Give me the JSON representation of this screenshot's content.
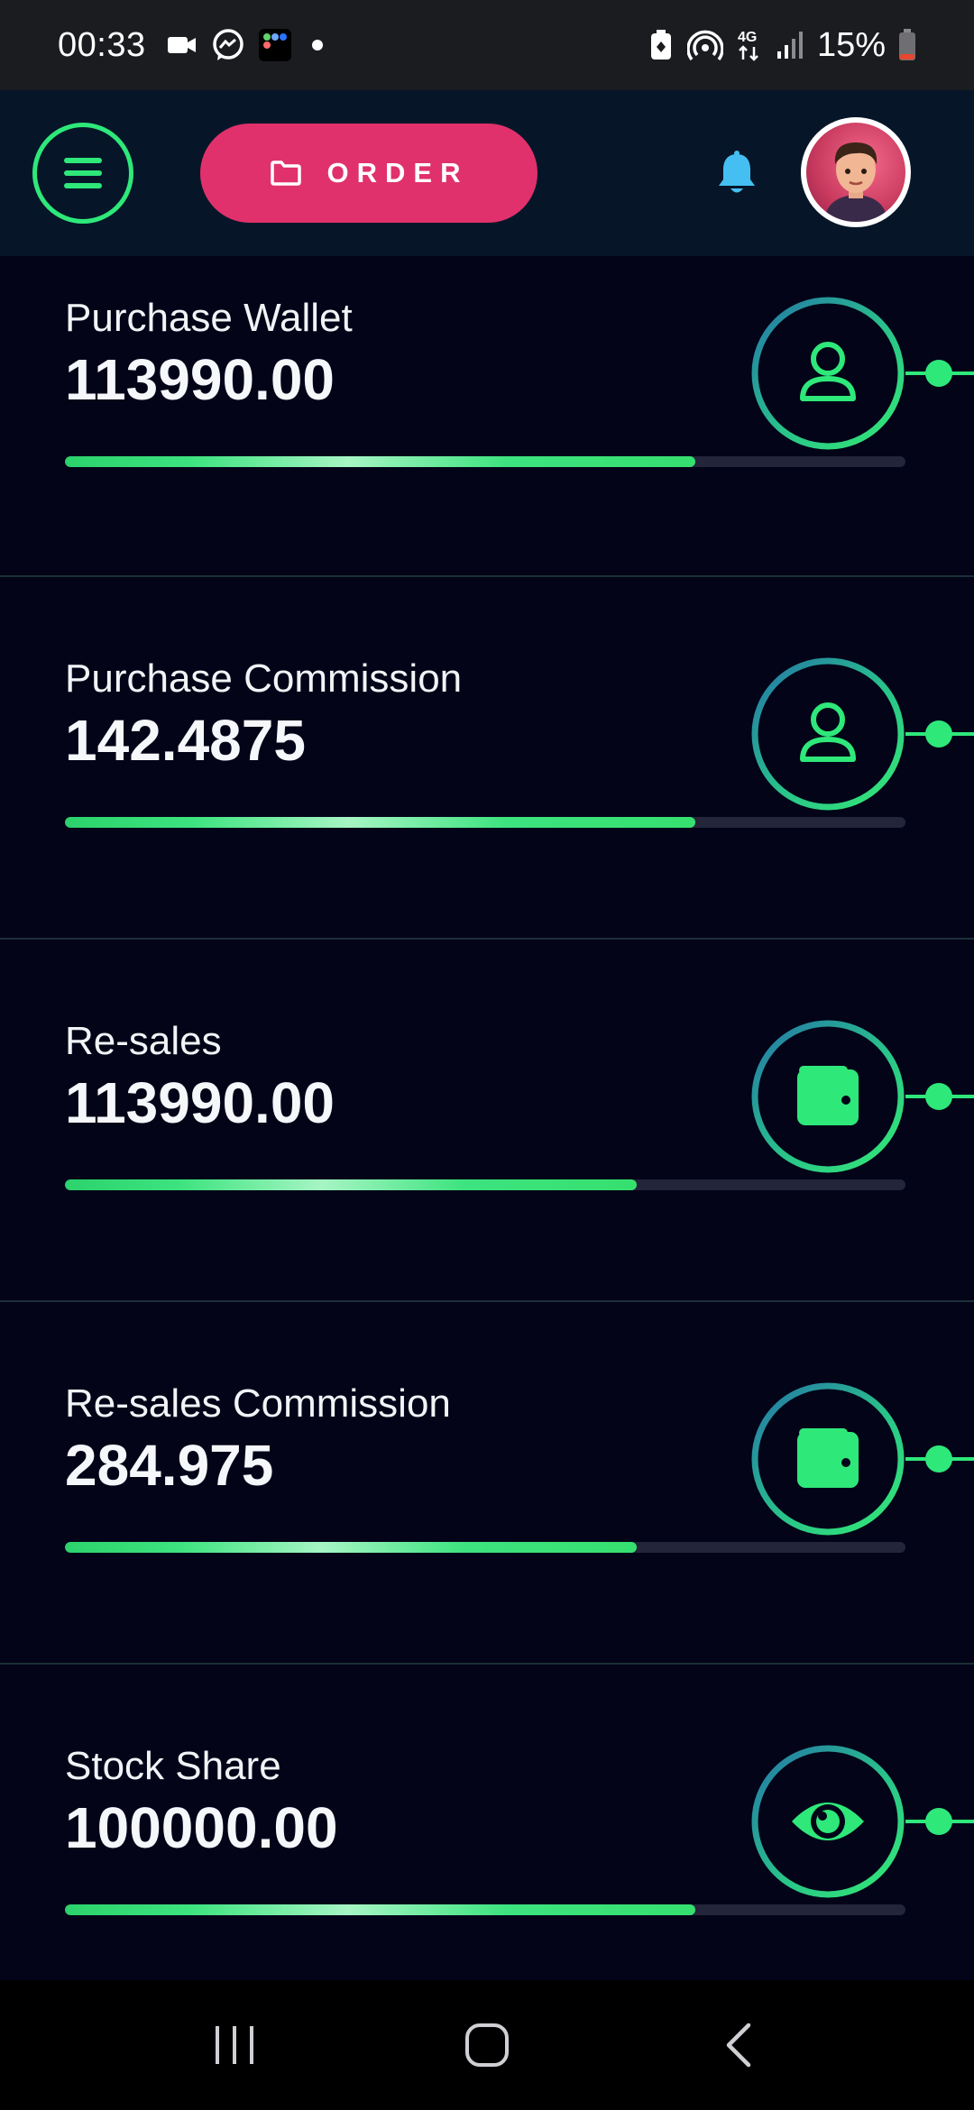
{
  "status_bar": {
    "time": "00:33",
    "battery": "15%",
    "icons": [
      "video-call-icon",
      "messenger-icon",
      "app-grid-icon",
      "battery-saver-icon",
      "hotspot-icon",
      "4g-icon",
      "signal-icon",
      "battery-icon"
    ]
  },
  "header": {
    "order_label": "ORDER",
    "icons": [
      "menu-icon",
      "folder-icon",
      "bell-icon",
      "avatar"
    ]
  },
  "cards": [
    {
      "title": "Purchase Wallet",
      "value": "113990.00",
      "progress": 0.75,
      "icon": "user-icon"
    },
    {
      "title": "Purchase Commission",
      "value": "142.4875",
      "progress": 0.75,
      "icon": "user-icon"
    },
    {
      "title": "Re-sales",
      "value": "113990.00",
      "progress": 0.68,
      "icon": "wallet-icon"
    },
    {
      "title": "Re-sales Commission",
      "value": "284.975",
      "progress": 0.68,
      "icon": "wallet-icon"
    },
    {
      "title": "Stock Share",
      "value": "100000.00",
      "progress": 0.75,
      "icon": "eye-icon"
    }
  ],
  "nav": {
    "icons": [
      "recent-apps-icon",
      "home-icon",
      "back-icon"
    ]
  },
  "colors": {
    "accent_green": "#2ee87a",
    "order_pink": "#e0316c",
    "header_bg": "#061628",
    "card_bg": "#030418",
    "bell_blue": "#45bff2"
  }
}
